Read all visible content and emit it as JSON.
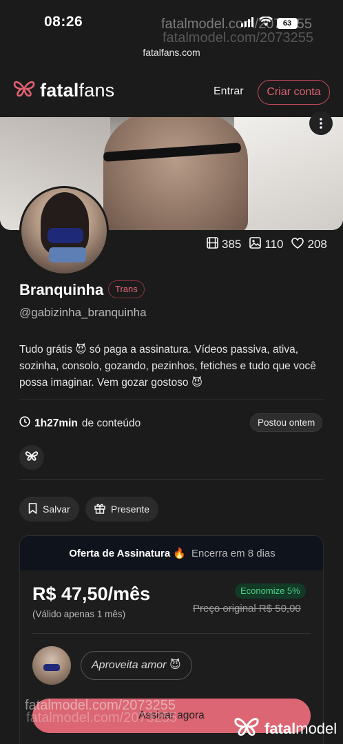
{
  "status_bar": {
    "time": "08:26",
    "battery": "63"
  },
  "watermark": {
    "text": "fatalmodel.com/2073255"
  },
  "browser": {
    "url": "fatalfans.com"
  },
  "header": {
    "brand_prefix": "fatal",
    "brand_suffix": "fans",
    "login": "Entrar",
    "signup": "Criar conta"
  },
  "profile": {
    "stats": {
      "videos": "385",
      "photos": "110",
      "likes": "208"
    },
    "name": "Branquinha",
    "tag": "Trans",
    "handle": "@gabizinha_branquinha",
    "bio": "Tudo grátis 😈 só paga a assinatura. Vídeos passiva, ativa, sozinha, consolo, gozando, pezinhos, fetiches e tudo que você possa imaginar. Vem gozar gostoso 😈",
    "duration_value": "1h27min",
    "duration_suffix": "de conteúdo",
    "posted": "Postou ontem"
  },
  "actions": {
    "save": "Salvar",
    "gift": "Presente"
  },
  "offer": {
    "title": "Oferta de Assinatura 🔥",
    "ends": "Encerra em 8 dias",
    "price": "R$ 47,50/mês",
    "valid": "(Válido apenas 1 mês)",
    "economy": "Economize 5%",
    "original": "Preço original R$ 50,00",
    "message": "Aproveita amor 😈",
    "cta": "Assinar agora"
  },
  "footer_logo": {
    "prefix": "fatal",
    "suffix": "model"
  },
  "colors": {
    "accent": "#dc6673",
    "green": "#4fd08a",
    "background": "#1b1b1b"
  }
}
